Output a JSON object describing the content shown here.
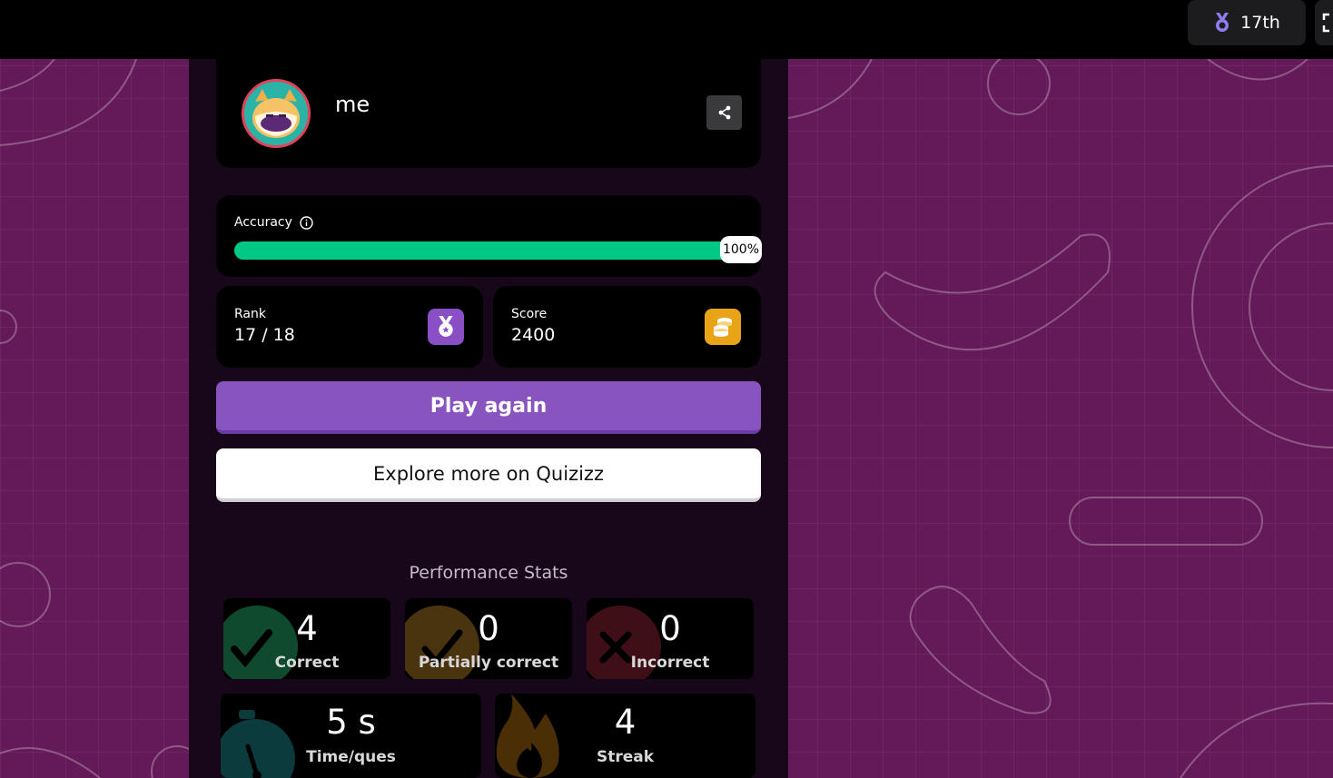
{
  "header": {
    "rank_badge": "17th",
    "rank_icon": "medal-icon",
    "fullscreen_icon": "fullscreen-icon"
  },
  "profile": {
    "name": "me",
    "avatar_icon": "monster-avatar",
    "share_icon": "share-icon"
  },
  "accuracy": {
    "label": "Accuracy",
    "info_icon": "info-icon",
    "value_percent": 100,
    "value_text": "100%"
  },
  "rank": {
    "label": "Rank",
    "value": "17 / 18",
    "icon": "medal-icon"
  },
  "score": {
    "label": "Score",
    "value": "2400",
    "icon": "coins-icon"
  },
  "buttons": {
    "play_again": "Play again",
    "explore": "Explore more on Quizizz"
  },
  "performance": {
    "title": "Performance Stats",
    "correct": {
      "value": "4",
      "label": "Correct"
    },
    "partial": {
      "value": "0",
      "label": "Partially correct"
    },
    "incorrect": {
      "value": "0",
      "label": "Incorrect"
    },
    "time": {
      "value": "5 s",
      "label": "Time/ques"
    },
    "streak": {
      "value": "4",
      "label": "Streak"
    }
  },
  "colors": {
    "background": "#641a58",
    "accent": "#8854c0",
    "progress": "#00c985",
    "gold": "#e8a317"
  }
}
